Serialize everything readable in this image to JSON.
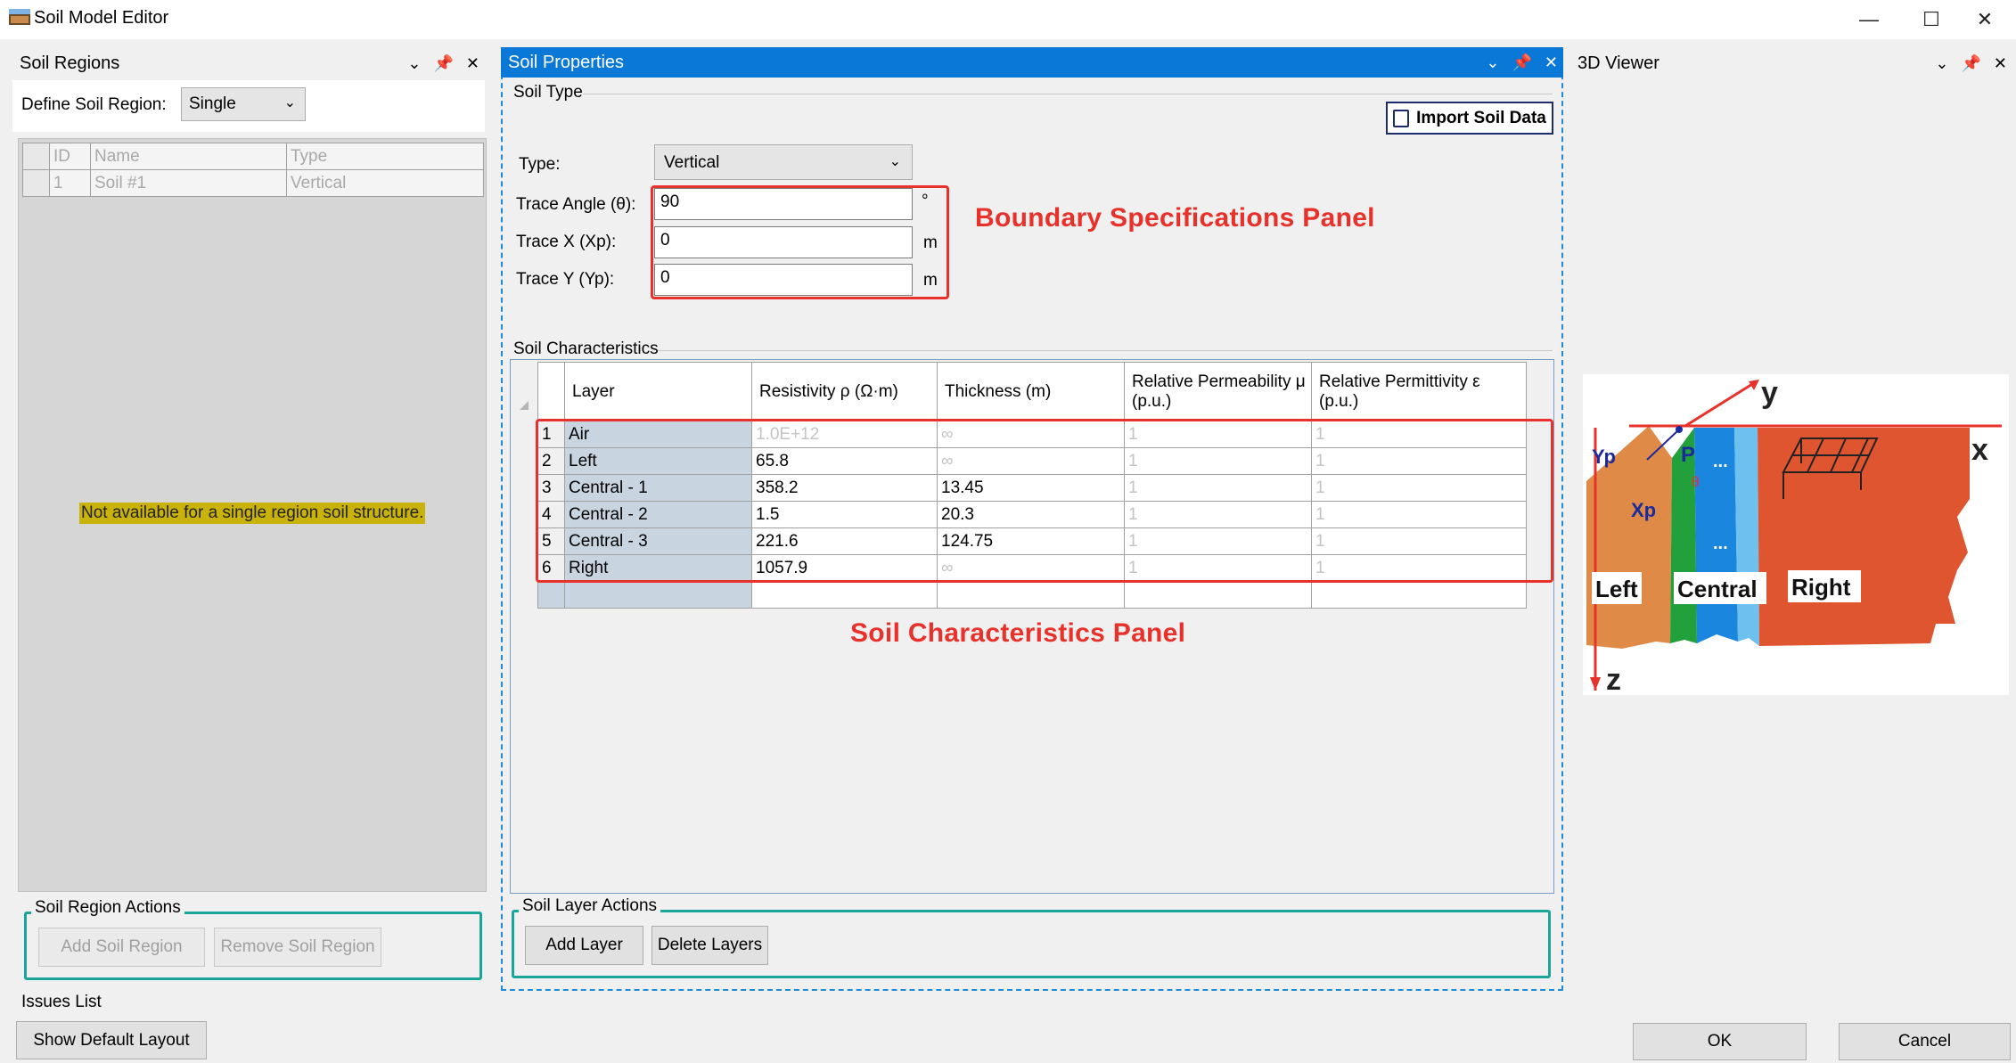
{
  "window": {
    "title": "Soil Model Editor",
    "minimize_icon": "minimize-icon",
    "maximize_icon": "maximize-icon",
    "close_icon": "close-icon"
  },
  "soil_regions": {
    "header": "Soil Regions",
    "define_label": "Define Soil Region:",
    "define_value": "Single",
    "columns": [
      "ID",
      "Name",
      "Type"
    ],
    "rows": [
      [
        "1",
        "Soil #1",
        "Vertical"
      ]
    ],
    "notice": "Not available for a single region soil structure.",
    "actions_label": "Soil Region Actions",
    "add_button": "Add Soil Region",
    "remove_button": "Remove Soil Region"
  },
  "soil_properties": {
    "header": "Soil Properties",
    "soil_type_label": "Soil Type",
    "import_button": "Import Soil Data",
    "type_label": "Type:",
    "type_value": "Vertical",
    "trace_angle_label": "Trace Angle (θ):",
    "trace_angle_value": "90",
    "trace_angle_unit": "°",
    "trace_x_label": "Trace X (Xp):",
    "trace_x_value": "0",
    "trace_x_unit": "m",
    "trace_y_label": "Trace Y (Yp):",
    "trace_y_value": "0",
    "trace_y_unit": "m",
    "boundary_annotation": "Boundary Specifications Panel",
    "soil_char_label": "Soil Characteristics",
    "soil_char_annotation": "Soil Characteristics Panel",
    "table_headers": [
      "Layer",
      "Resistivity ρ (Ω·m)",
      "Thickness (m)",
      "Relative Permeability μ (p.u.)",
      "Relative Permittivity ε (p.u.)"
    ],
    "table_rows": [
      {
        "n": "1",
        "layer": "Air",
        "res": "1.0E+12",
        "thk": "∞",
        "mu": "1",
        "eps": "1"
      },
      {
        "n": "2",
        "layer": "Left",
        "res": "65.8",
        "thk": "∞",
        "mu": "1",
        "eps": "1"
      },
      {
        "n": "3",
        "layer": "Central - 1",
        "res": "358.2",
        "thk": "13.45",
        "mu": "1",
        "eps": "1"
      },
      {
        "n": "4",
        "layer": "Central - 2",
        "res": "1.5",
        "thk": "20.3",
        "mu": "1",
        "eps": "1"
      },
      {
        "n": "5",
        "layer": "Central - 3",
        "res": "221.6",
        "thk": "124.75",
        "mu": "1",
        "eps": "1"
      },
      {
        "n": "6",
        "layer": "Right",
        "res": "1057.9",
        "thk": "∞",
        "mu": "1",
        "eps": "1"
      }
    ],
    "layer_actions_label": "Soil Layer Actions",
    "add_layer_button": "Add Layer",
    "delete_layers_button": "Delete Layers"
  },
  "viewer": {
    "header": "3D Viewer",
    "axis_x": "x",
    "axis_y": "y",
    "axis_z": "z",
    "label_yp": "Yp",
    "label_xp": "Xp",
    "label_p": "P",
    "label_theta": "θ",
    "label_left": "Left",
    "label_central": "Central",
    "label_right": "Right",
    "dots": "..."
  },
  "footer": {
    "issues_label": "Issues List",
    "default_layout_button": "Show Default Layout",
    "ok_button": "OK",
    "cancel_button": "Cancel"
  },
  "colors": {
    "accent_blue": "#0a78d7",
    "annotation_red": "#e8312a",
    "group_teal": "#1aa59b",
    "notice_yellow": "#c9b30a"
  }
}
